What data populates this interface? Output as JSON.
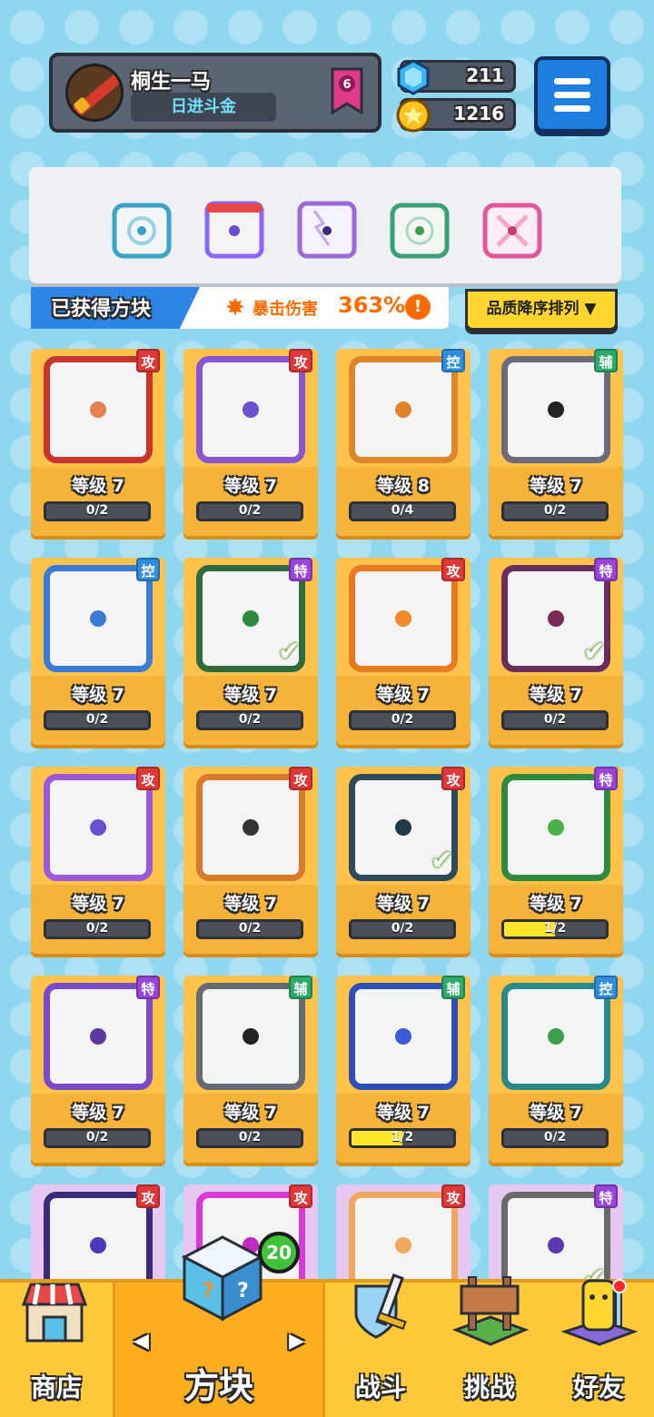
{
  "player": {
    "name": "桐生一马",
    "rank": "日进斗金",
    "level_badge": "6"
  },
  "currency": {
    "gems": "211",
    "coins": "1216"
  },
  "equipped": [
    {
      "icon": "vortex-blue",
      "color": "#3aa4c8"
    },
    {
      "icon": "rainbow-orb",
      "color": "#8a66ff"
    },
    {
      "icon": "lightning-purple",
      "color": "#9a6ad8"
    },
    {
      "icon": "compass-green",
      "color": "#3aa077"
    },
    {
      "icon": "cross-pink",
      "color": "#e2569a"
    }
  ],
  "banner": {
    "title": "已获得方块",
    "stat_label": "暴击伤害",
    "stat_value": "363%",
    "info": "!"
  },
  "sort": {
    "label": "品质降序排列 ▼"
  },
  "cards": [
    {
      "type": "攻",
      "tag_color": "red",
      "level": "等级 7",
      "progress": "0/2",
      "fill": 0,
      "frame": "#c9342f",
      "dot": "#e87f4d",
      "checked": false
    },
    {
      "type": "攻",
      "tag_color": "red",
      "level": "等级 7",
      "progress": "0/2",
      "fill": 0,
      "frame": "#8a55d1",
      "dot": "#6a4fd0",
      "checked": false
    },
    {
      "type": "控",
      "tag_color": "blue",
      "level": "等级 8",
      "progress": "0/4",
      "fill": 0,
      "frame": "#e0852a",
      "dot": "#e0852a",
      "checked": false
    },
    {
      "type": "辅",
      "tag_color": "green",
      "level": "等级 7",
      "progress": "0/2",
      "fill": 0,
      "frame": "#6b6b7c",
      "dot": "#222222",
      "checked": false
    },
    {
      "type": "控",
      "tag_color": "blue",
      "level": "等级 7",
      "progress": "0/2",
      "fill": 0,
      "frame": "#3b7bd8",
      "dot": "#3b7bd8",
      "checked": false
    },
    {
      "type": "特",
      "tag_color": "purple",
      "level": "等级 7",
      "progress": "0/2",
      "fill": 0,
      "frame": "#2f6b3f",
      "dot": "#2d8a3d",
      "checked": true
    },
    {
      "type": "攻",
      "tag_color": "red",
      "level": "等级 7",
      "progress": "0/2",
      "fill": 0,
      "frame": "#e87a1f",
      "dot": "#f08a2a",
      "checked": false
    },
    {
      "type": "特",
      "tag_color": "purple",
      "level": "等级 7",
      "progress": "0/2",
      "fill": 0,
      "frame": "#6a2e5c",
      "dot": "#7a2a55",
      "checked": true
    },
    {
      "type": "攻",
      "tag_color": "red",
      "level": "等级 7",
      "progress": "0/2",
      "fill": 0,
      "frame": "#9a5ad8",
      "dot": "#6a4fd0",
      "checked": false
    },
    {
      "type": "攻",
      "tag_color": "red",
      "level": "等级 7",
      "progress": "0/2",
      "fill": 0,
      "frame": "#d77a2a",
      "dot": "#333333",
      "checked": false
    },
    {
      "type": "攻",
      "tag_color": "red",
      "level": "等级 7",
      "progress": "0/2",
      "fill": 0,
      "frame": "#2f4a58",
      "dot": "#1e3a48",
      "checked": true
    },
    {
      "type": "特",
      "tag_color": "purple",
      "level": "等级 7",
      "progress": "1/2",
      "fill": 0.5,
      "frame": "#2f8a3f",
      "dot": "#4ab04a",
      "checked": false
    },
    {
      "type": "特",
      "tag_color": "purple",
      "level": "等级 7",
      "progress": "0/2",
      "fill": 0,
      "frame": "#7a4ac8",
      "dot": "#5a3aa0",
      "checked": false
    },
    {
      "type": "辅",
      "tag_color": "green",
      "level": "等级 7",
      "progress": "0/2",
      "fill": 0,
      "frame": "#666a72",
      "dot": "#222222",
      "checked": false
    },
    {
      "type": "辅",
      "tag_color": "green",
      "level": "等级 7",
      "progress": "1/2",
      "fill": 0.5,
      "frame": "#2f4fb8",
      "dot": "#3b5ad8",
      "checked": false
    },
    {
      "type": "控",
      "tag_color": "blue",
      "level": "等级 7",
      "progress": "0/2",
      "fill": 0,
      "frame": "#2a8a8a",
      "dot": "#3aa04a",
      "checked": false
    },
    {
      "type": "攻",
      "tag_color": "red",
      "frame": "#3a2a7a",
      "dot": "#4a3ab8",
      "checked": false,
      "partial": true
    },
    {
      "type": "攻",
      "tag_color": "red",
      "frame": "#d83ad8",
      "dot": "#c02ac0",
      "checked": false,
      "partial": true
    },
    {
      "type": "攻",
      "tag_color": "red",
      "frame": "#f0a860",
      "dot": "#f0a860",
      "checked": false,
      "partial": true
    },
    {
      "type": "特",
      "tag_color": "purple",
      "frame": "#6a6a6a",
      "dot": "#5a3ab0",
      "checked": true,
      "partial": true
    }
  ],
  "nav": {
    "shop": "商店",
    "blocks": "方块",
    "battle": "战斗",
    "challenge": "挑战",
    "friends": "好友",
    "blocks_badge": "20",
    "prev": "◀",
    "next": "▶"
  }
}
